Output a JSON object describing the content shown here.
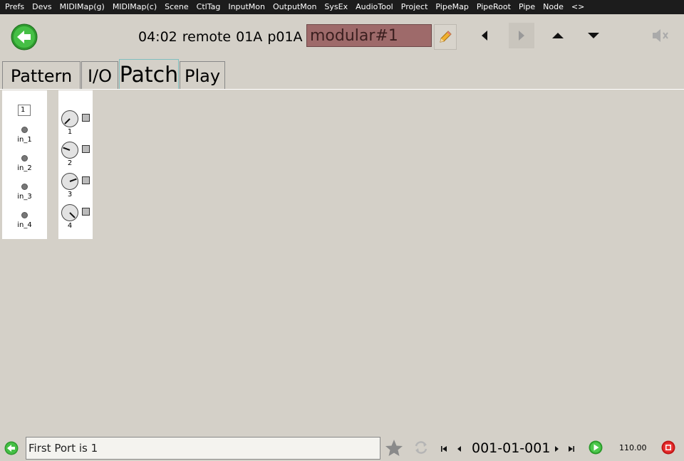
{
  "menu": [
    "Prefs",
    "Devs",
    "MIDIMap(g)",
    "MIDIMap(c)",
    "Scene",
    "CtlTag",
    "InputMon",
    "OutputMon",
    "SysEx",
    "AudioTool",
    "Project",
    "PipeMap",
    "PipeRoot",
    "Pipe",
    "Node",
    "<>"
  ],
  "header": {
    "time": "04:02",
    "mode": "remote",
    "bank": "01A",
    "program": "p01A :",
    "name_value": "modular#1"
  },
  "tabs": [
    "Pattern",
    "I/O",
    "Patch",
    "Play"
  ],
  "active_tab": "Patch",
  "inputs": {
    "first_port": "1",
    "ports": [
      "in_1",
      "in_2",
      "in_3",
      "in_4"
    ]
  },
  "knobs": [
    {
      "label": "1",
      "angle": 225
    },
    {
      "label": "2",
      "angle": 290
    },
    {
      "label": "3",
      "angle": 70
    },
    {
      "label": "4",
      "angle": 135
    }
  ],
  "footer": {
    "message": "First Port is 1",
    "position": "001-01-001",
    "tempo": "110.00"
  },
  "colors": {
    "background": "#d4d0c8",
    "menubar": "#1c1c1c",
    "name_field": "#9e6a6a",
    "accent_green": "#3cb43c",
    "stop_red": "#e02020"
  }
}
